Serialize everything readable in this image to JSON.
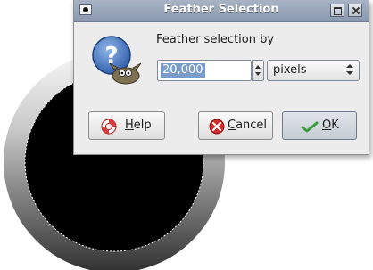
{
  "dialog": {
    "title": "Feather Selection",
    "prompt": "Feather selection by",
    "value": "20,000",
    "unit": "pixels"
  },
  "buttons": {
    "help": {
      "mnemonic": "H",
      "rest": "elp"
    },
    "cancel": {
      "mnemonic": "C",
      "rest": "ancel"
    },
    "ok": {
      "mnemonic": "O",
      "rest": "K"
    }
  },
  "icons": {
    "prompt": "question-mark-wilber-icon",
    "help": "lifebuoy-icon",
    "cancel": "cancel-x-icon",
    "ok": "checkmark-icon"
  },
  "colors": {
    "title_bar": "#8a98ae",
    "selection": "#7a9cc9",
    "cancel_red": "#d22a2a",
    "ok_green": "#3b9b3b"
  }
}
